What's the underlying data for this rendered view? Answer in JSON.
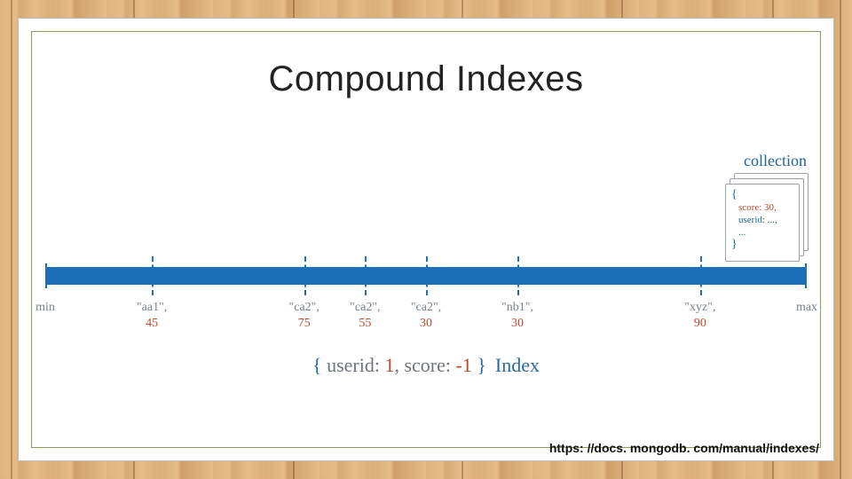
{
  "title": "Compound Indexes",
  "collection_label": "collection",
  "document_sample": {
    "score_line": "score: 30,",
    "userid_line": "userid: ...,",
    "ellipsis": "..."
  },
  "axis": {
    "min_label": "min",
    "max_label": "max",
    "entries": [
      {
        "userid": "\"aa1\",",
        "score": "45",
        "pos_pct": 14
      },
      {
        "userid": "\"ca2\",",
        "score": "75",
        "pos_pct": 34
      },
      {
        "userid": "\"ca2\",",
        "score": "55",
        "pos_pct": 42
      },
      {
        "userid": "\"ca2\",",
        "score": "30",
        "pos_pct": 50
      },
      {
        "userid": "\"nb1\",",
        "score": "30",
        "pos_pct": 62
      },
      {
        "userid": "\"xyz\",",
        "score": "90",
        "pos_pct": 86
      }
    ]
  },
  "index_spec": {
    "open": "{",
    "field1": " userid:",
    "val1": " 1",
    "comma": ",",
    "field2": " score:",
    "val2": " -1 ",
    "close": "}",
    "label": "Index"
  },
  "source_url": "https: //docs. mongodb. com/manual/indexes/",
  "chart_data": {
    "type": "table",
    "title": "Compound index ordering on (userid asc, score desc)",
    "columns": [
      "userid",
      "score"
    ],
    "rows": [
      [
        "aa1",
        45
      ],
      [
        "ca2",
        75
      ],
      [
        "ca2",
        55
      ],
      [
        "ca2",
        30
      ],
      [
        "nb1",
        30
      ],
      [
        "xyz",
        90
      ]
    ],
    "range_labels": [
      "min",
      "max"
    ],
    "index_definition": {
      "userid": 1,
      "score": -1
    }
  }
}
